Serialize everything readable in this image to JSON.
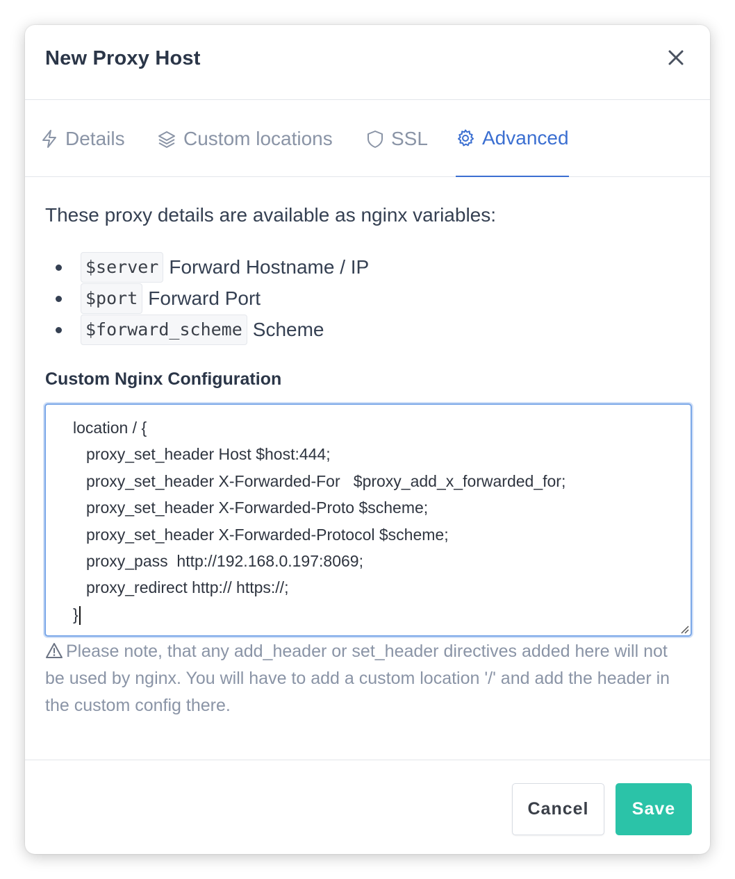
{
  "modal": {
    "title": "New Proxy Host"
  },
  "tabs": [
    {
      "label": "Details",
      "icon": "bolt-icon",
      "active": false
    },
    {
      "label": "Custom locations",
      "icon": "layers-icon",
      "active": false
    },
    {
      "label": "SSL",
      "icon": "shield-icon",
      "active": false
    },
    {
      "label": "Advanced",
      "icon": "gear-icon",
      "active": true
    }
  ],
  "advanced": {
    "intro": "These proxy details are available as nginx variables:",
    "variables": [
      {
        "code": "$server",
        "desc": "Forward Hostname / IP"
      },
      {
        "code": "$port",
        "desc": "Forward Port"
      },
      {
        "code": "$forward_scheme",
        "desc": "Scheme"
      }
    ],
    "config_label": "Custom Nginx Configuration",
    "config_lines": [
      "location / {",
      "proxy_set_header Host $host:444;",
      "proxy_set_header X-Forwarded-For   $proxy_add_x_forwarded_for;",
      "proxy_set_header X-Forwarded-Proto $scheme;",
      "proxy_set_header X-Forwarded-Protocol $scheme;",
      "proxy_pass  http://192.168.0.197:8069;",
      "proxy_redirect http:// https://;",
      "}"
    ],
    "note": "Please note, that any add_header or set_header directives added here will not be used by nginx. You will have to add a custom location '/' and add the header in the custom config there."
  },
  "footer": {
    "cancel_label": "Cancel",
    "save_label": "Save"
  },
  "colors": {
    "accent": "#3b6fd1",
    "save": "#2bc3a8",
    "muted_text": "#8a94a6"
  }
}
